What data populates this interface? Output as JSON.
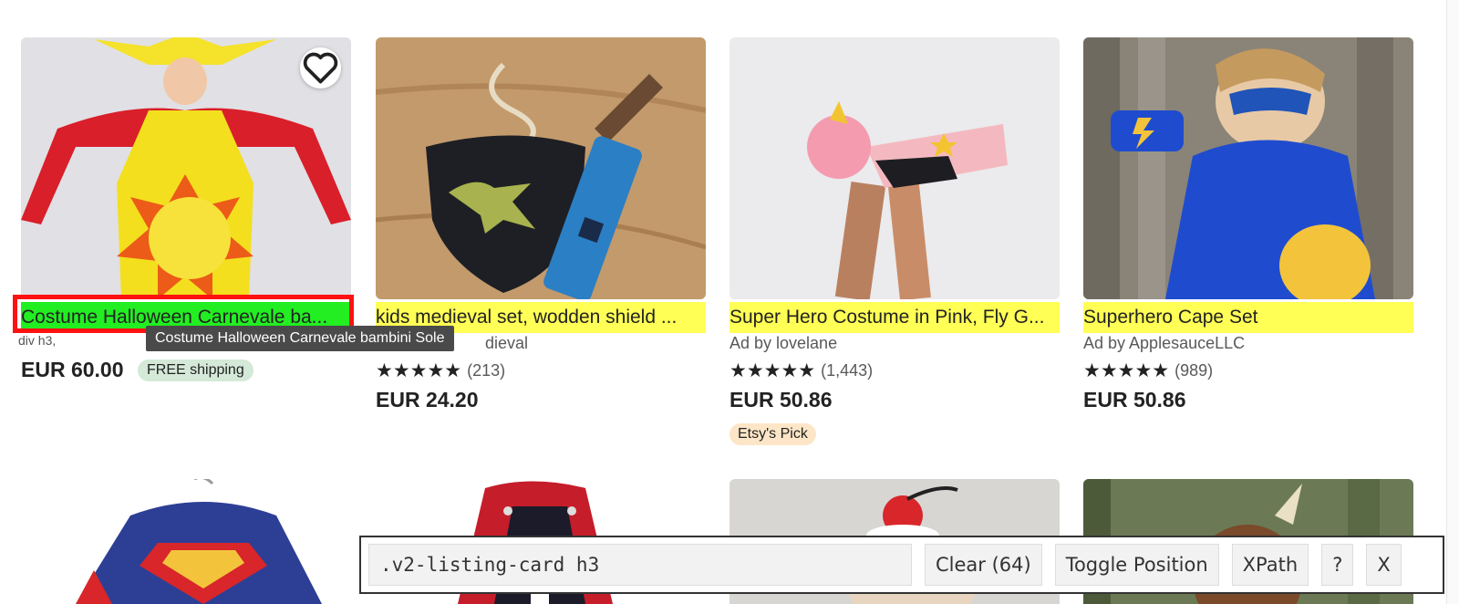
{
  "cards": [
    {
      "title": "Costume Halloween Carnevale bambini Sole",
      "title_display": "Costume Halloween Carnevale ba...",
      "price": "EUR 60.00",
      "badge": "FREE shipping",
      "favorite_icon": "heart-icon"
    },
    {
      "title_display": "kids medieval set, wodden shield ...",
      "shop": "dieval",
      "stars": "★★★★★",
      "reviews": "(213)",
      "price": "EUR 24.20"
    },
    {
      "title_display": "Super Hero Costume in Pink, Fly G...",
      "shop": "Ad by lovelane",
      "stars": "★★★★★",
      "reviews": "(1,443)",
      "price": "EUR 50.86",
      "badge": "Etsy's Pick"
    },
    {
      "title_display": "Superhero Cape Set",
      "shop": "Ad by ApplesauceLLC",
      "stars": "★★★★★",
      "reviews": "(989)",
      "price": "EUR 50.86"
    }
  ],
  "selector_overlay": {
    "element_label": "div h3,",
    "tooltip": "Costume Halloween Carnevale bambini Sole",
    "outline_color": "#ff1111",
    "match_highlight": "#ffff55",
    "selected_highlight": "#22ee22"
  },
  "toolbar": {
    "selector_value": ".v2-listing-card h3",
    "clear_label": "Clear (64)",
    "toggle_label": "Toggle Position",
    "xpath_label": "XPath",
    "help_label": "?",
    "close_label": "X"
  }
}
